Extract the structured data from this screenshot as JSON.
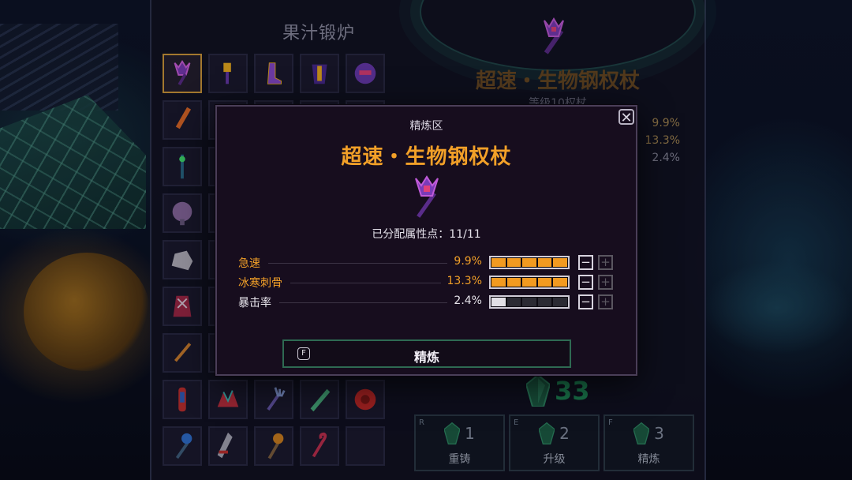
{
  "forge": {
    "title": "果汁锻炉",
    "selected_item_name": "超速・生物钢权杖",
    "selected_item_sub": "等级10权杖",
    "bg_stats": [
      "9.9%",
      "13.3%",
      "2.4%"
    ],
    "gem_count": "33",
    "actions": [
      {
        "key": "R",
        "count": "1",
        "label": "重铸"
      },
      {
        "key": "E",
        "count": "2",
        "label": "升级"
      },
      {
        "key": "F",
        "count": "3",
        "label": "精炼"
      }
    ],
    "inventory": [
      "scepter-icon",
      "hammer-icon",
      "boot-icon",
      "armor-icon",
      "helmet-icon",
      "sword-icon",
      "",
      "",
      "",
      "",
      "staff-icon",
      "",
      "",
      "",
      "",
      "brain-icon",
      "",
      "",
      "",
      "",
      "rock-icon",
      "",
      "",
      "",
      "",
      "robe-icon",
      "",
      "",
      "",
      "",
      "dagger-icon",
      "",
      "",
      "",
      "",
      "tube-icon",
      "claw-icon",
      "trident-icon",
      "blade-icon",
      "shield-icon",
      "orb-staff-icon",
      "greatsword-icon",
      "mace-icon",
      "hook-icon",
      ""
    ]
  },
  "modal": {
    "header": "精炼区",
    "item_name": "超速・生物钢权杖",
    "points_label": "已分配属性点：11/11",
    "stats": [
      {
        "label": "急速",
        "value": "9.9%",
        "filled": 5,
        "total": 5,
        "color": "orange"
      },
      {
        "label": "冰寒刺骨",
        "value": "13.3%",
        "filled": 5,
        "total": 5,
        "color": "orange"
      },
      {
        "label": "暴击率",
        "value": "2.4%",
        "filled": 1,
        "total": 5,
        "color": "white"
      }
    ],
    "minus_symbol": "−",
    "plus_symbol": "+",
    "close_symbol": "✕",
    "refine_key": "F",
    "refine_label": "精炼"
  },
  "colors": {
    "accent_orange": "#f2a028",
    "gem_green": "#1f8f5c",
    "modal_bg": "#170d1e"
  }
}
